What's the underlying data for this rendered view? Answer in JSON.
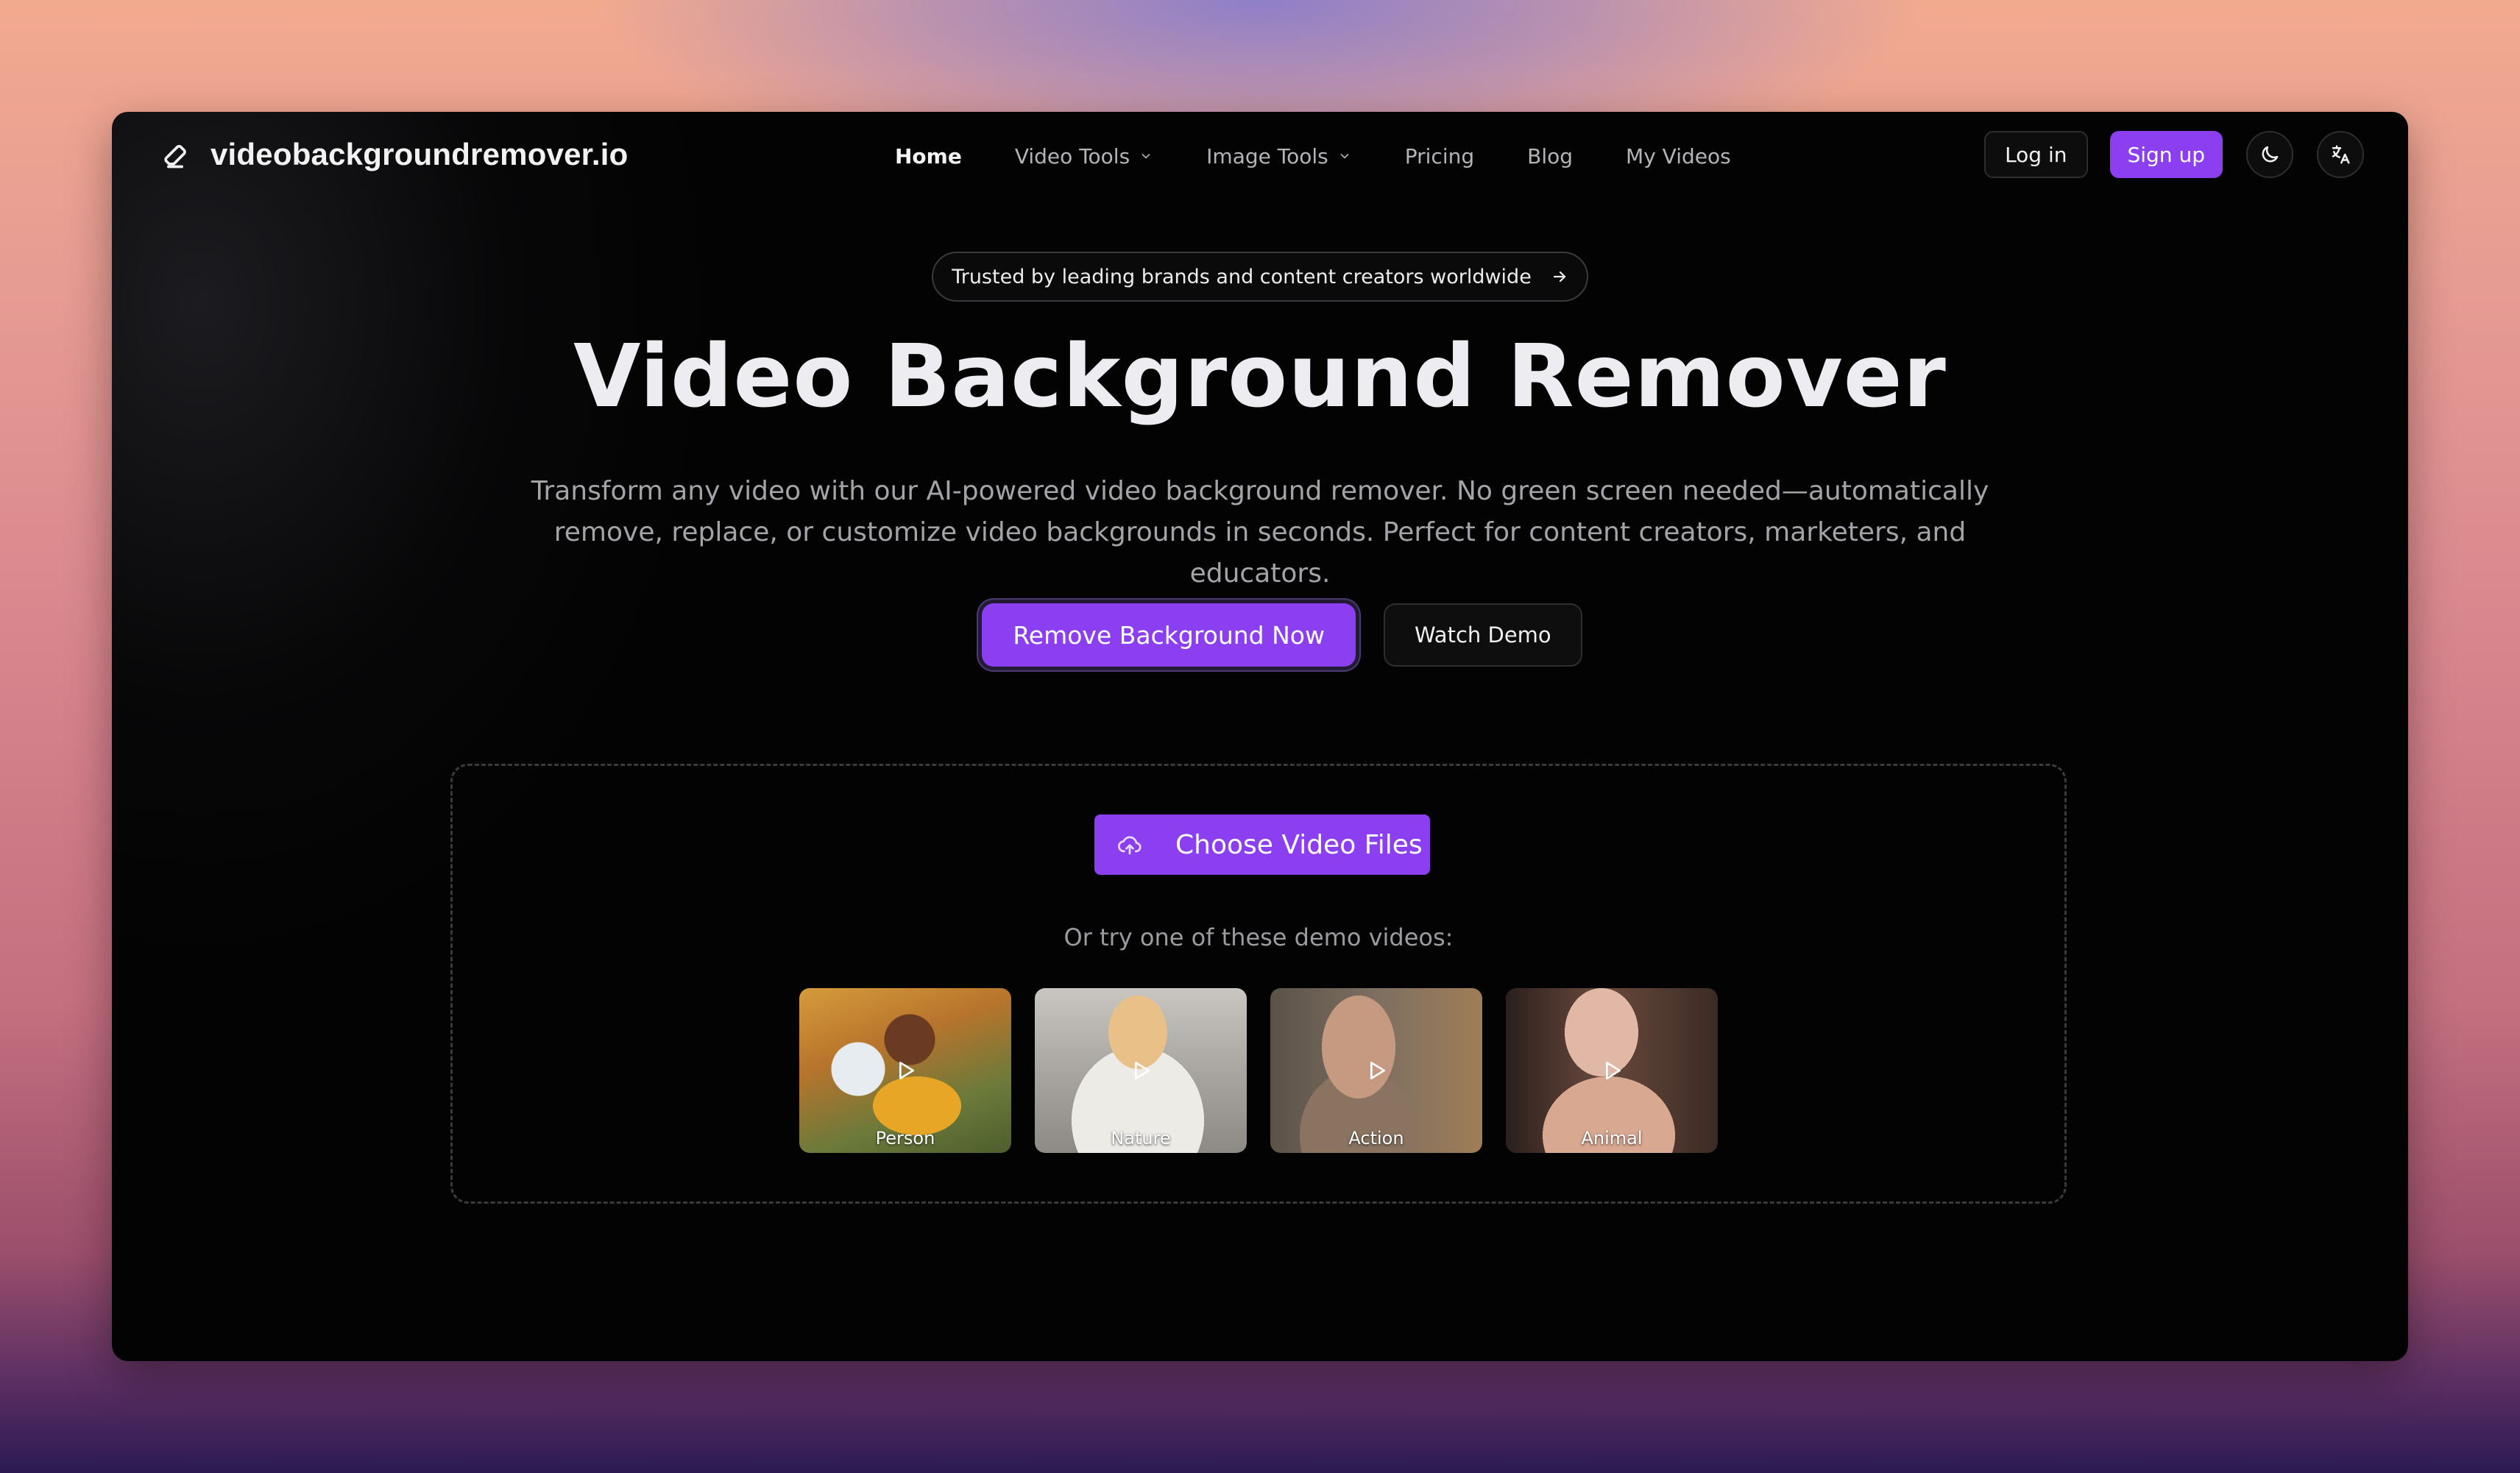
{
  "brand": {
    "name": "videobackgroundremover.io",
    "icon": "eraser-icon"
  },
  "nav": {
    "items": [
      {
        "label": "Home",
        "active": true
      },
      {
        "label": "Video Tools",
        "dropdown": true
      },
      {
        "label": "Image Tools",
        "dropdown": true
      },
      {
        "label": "Pricing"
      },
      {
        "label": "Blog"
      },
      {
        "label": "My Videos"
      }
    ],
    "login_label": "Log in",
    "signup_label": "Sign up",
    "theme_icon": "moon-icon",
    "language_icon": "translate-icon"
  },
  "hero": {
    "badge": "Trusted by leading brands and content creators worldwide",
    "title": "Video Background Remover",
    "subtitle_line1": "Transform any video with our AI-powered video background remover. No green screen needed—automatically",
    "subtitle_line2": "remove, replace, or customize video backgrounds in seconds. Perfect for content creators, marketers, and educators.",
    "primary_cta": "Remove Background Now",
    "secondary_cta": "Watch Demo"
  },
  "upload": {
    "choose_label": "Choose Video Files",
    "demo_prompt": "Or try one of these demo videos:",
    "demos": [
      {
        "label": "Person"
      },
      {
        "label": "Nature"
      },
      {
        "label": "Action"
      },
      {
        "label": "Animal"
      }
    ]
  },
  "colors": {
    "accent": "#8b3ff0",
    "background": "#030303"
  }
}
